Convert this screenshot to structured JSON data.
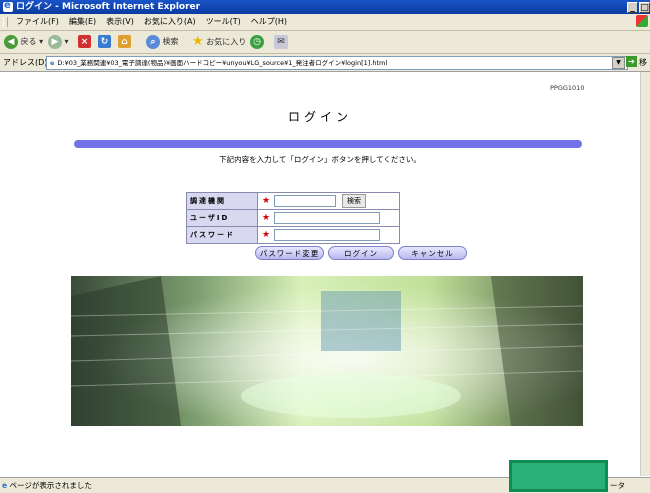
{
  "window": {
    "title": "ログイン - Microsoft Internet Explorer"
  },
  "menu": [
    "ファイル(F)",
    "編集(E)",
    "表示(V)",
    "お気に入り(A)",
    "ツール(T)",
    "ヘルプ(H)"
  ],
  "toolbar": {
    "back": "戻る",
    "search": "検索",
    "favorites": "お気に入り"
  },
  "address": {
    "label": "アドレス(D)",
    "value": "D:¥03_業務関連¥03_電子調達(物品)¥画面ハードコピー¥unyou¥LG_source¥1_発注者ログイン¥login[1].html",
    "go": "移動"
  },
  "page": {
    "id": "PPGG1010",
    "title": "ログイン",
    "instruction": "下記内容を入力して「ログイン」ボタンを押してください。",
    "fields": [
      {
        "label": "調達機関",
        "value": "",
        "has_search": true,
        "search_label": "検索"
      },
      {
        "label": "ユーザID",
        "value": "",
        "has_search": false
      },
      {
        "label": "パスワード",
        "value": "",
        "has_search": false
      }
    ],
    "buttons": {
      "change_password": "パスワード変更",
      "login": "ログイン",
      "cancel": "キャンセル"
    }
  },
  "status": {
    "text": "ページが表示されました",
    "zone": "ータ"
  },
  "colors": {
    "accent_bar": "#7373e8",
    "required": "#dd0000",
    "label_bg": "#d8d8f0"
  }
}
